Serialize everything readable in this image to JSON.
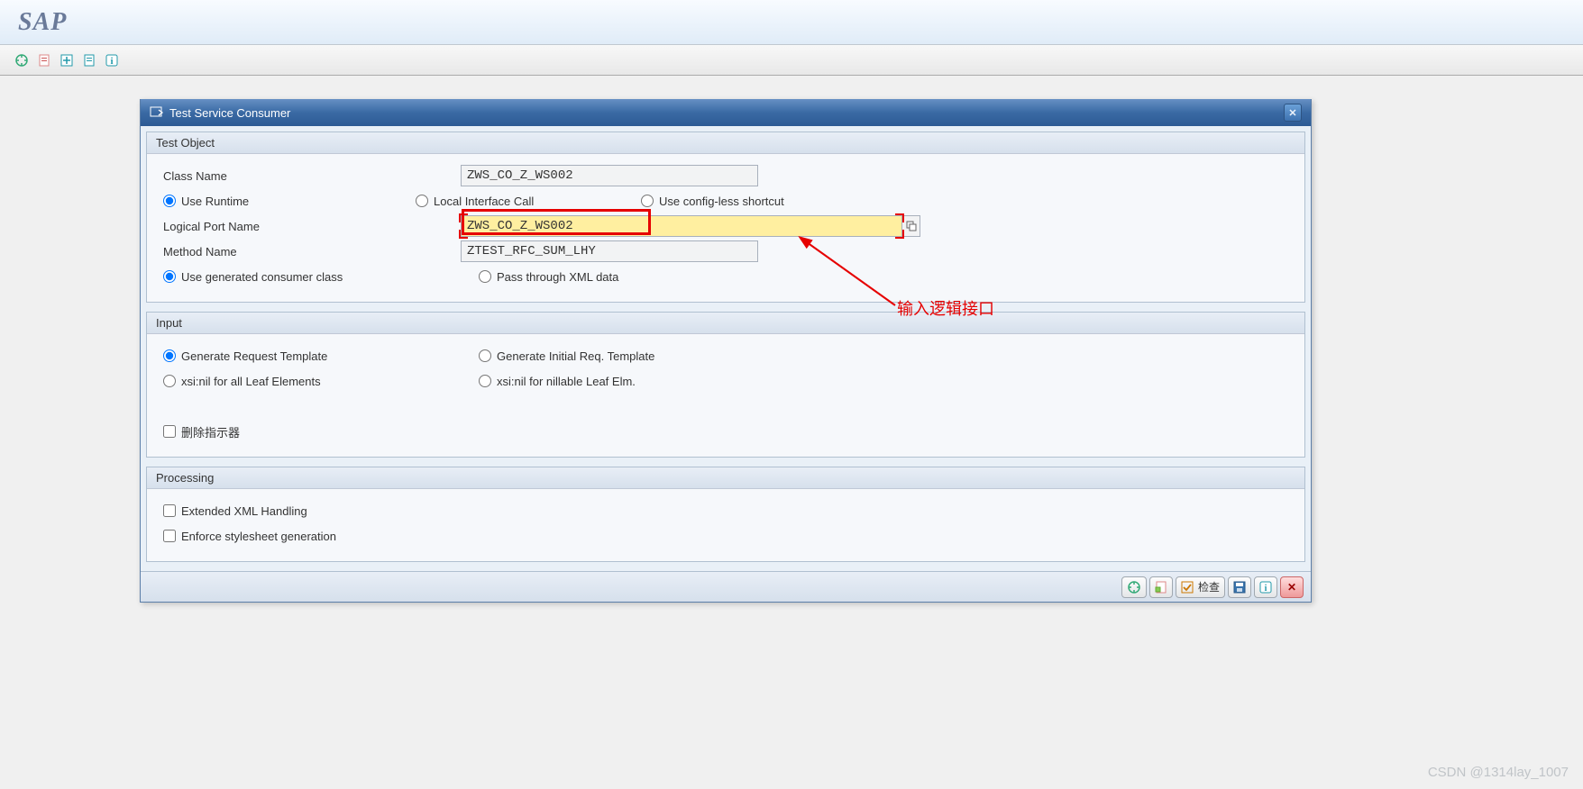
{
  "header": {
    "logo": "SAP"
  },
  "dialog": {
    "title": "Test Service Consumer",
    "groups": {
      "test_object": {
        "title": "Test Object",
        "class_name_label": "Class Name",
        "class_name_value": "ZWS_CO_Z_WS002",
        "runtime_opts": {
          "use_runtime": "Use Runtime",
          "local_call": "Local Interface Call",
          "configless": "Use config-less shortcut"
        },
        "logical_port_label": "Logical Port Name",
        "logical_port_value": "ZWS_CO_Z_WS002",
        "method_name_label": "Method Name",
        "method_name_value": "ZTEST_RFC_SUM_LHY",
        "consumer_opts": {
          "use_generated": "Use generated consumer class",
          "pass_xml": "Pass through XML data"
        }
      },
      "input": {
        "title": "Input",
        "req_opts": {
          "gen_req": "Generate Request Template",
          "gen_init": "Generate Initial Req. Template"
        },
        "xsi_opts": {
          "all_leaf": "xsi:nil for all Leaf Elements",
          "nillable": "xsi:nil for nillable Leaf Elm."
        },
        "delete_indicator": "删除指示器"
      },
      "processing": {
        "title": "Processing",
        "ext_xml": "Extended XML Handling",
        "enforce_xsl": "Enforce stylesheet generation"
      }
    },
    "footer": {
      "check_label": "检查"
    }
  },
  "annotation": "输入逻辑接口",
  "watermark": "CSDN @1314lay_1007"
}
